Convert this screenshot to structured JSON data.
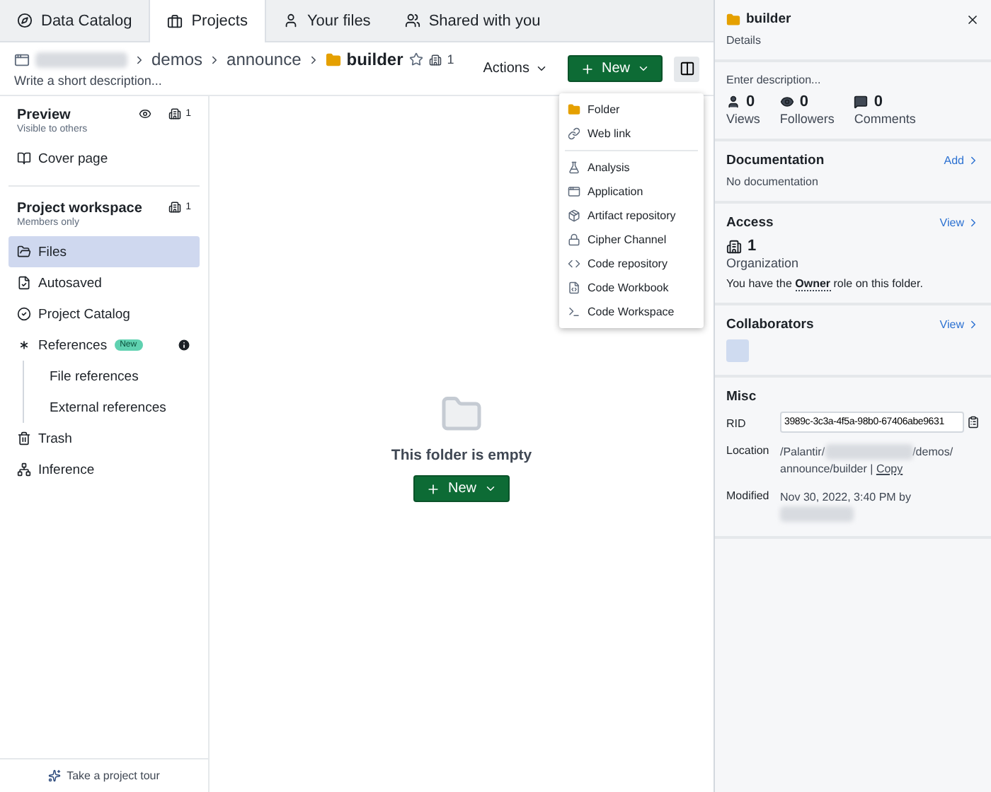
{
  "tabs": [
    {
      "label": "Data Catalog",
      "selected": false
    },
    {
      "label": "Projects",
      "selected": true
    },
    {
      "label": "Your files",
      "selected": false
    },
    {
      "label": "Shared with you",
      "selected": false
    }
  ],
  "header": {
    "breadcrumbs": [
      "demos",
      "announce"
    ],
    "current": "builder",
    "starred": false,
    "org_count": "1",
    "description_placeholder": "Write a short description...",
    "actions_label": "Actions",
    "new_label": "New"
  },
  "new_menu": {
    "groups": [
      [
        "Folder",
        "Web link"
      ],
      [
        "Analysis",
        "Application",
        "Artifact repository",
        "Cipher Channel",
        "Code repository",
        "Code Workbook",
        "Code Workspace"
      ]
    ]
  },
  "sidebar": {
    "preview": {
      "title": "Preview",
      "subtitle": "Visible to others",
      "count": "1",
      "items": [
        {
          "label": "Cover page",
          "selected": false
        }
      ]
    },
    "workspace": {
      "title": "Project workspace",
      "subtitle": "Members only",
      "count": "1",
      "items": [
        {
          "label": "Files",
          "selected": true
        },
        {
          "label": "Autosaved",
          "selected": false
        },
        {
          "label": "Project Catalog",
          "selected": false
        },
        {
          "label": "References",
          "selected": false,
          "badge": "New",
          "children": [
            {
              "label": "File references",
              "selected": false
            },
            {
              "label": "External references",
              "selected": false
            }
          ]
        },
        {
          "label": "Trash",
          "selected": false
        },
        {
          "label": "Inference",
          "selected": false
        }
      ]
    },
    "tour_label": "Take a project tour"
  },
  "empty_state": {
    "message": "This folder is empty",
    "new_label": "New"
  },
  "details": {
    "name": "builder",
    "subtitle": "Details",
    "description_placeholder": "Enter description...",
    "stats": [
      {
        "value": "0",
        "label": "Views"
      },
      {
        "value": "0",
        "label": "Followers"
      },
      {
        "value": "0",
        "label": "Comments"
      }
    ],
    "documentation": {
      "title": "Documentation",
      "action": "Add",
      "text": "No documentation"
    },
    "access": {
      "title": "Access",
      "action": "View",
      "count": "1",
      "count_label": "Organization",
      "role_text": "You have the **Owner** role on this folder."
    },
    "collaborators": {
      "title": "Collaborators",
      "action": "View"
    },
    "misc": {
      "title": "Misc",
      "rid_label": "RID",
      "rid": "3989c-3c3a-4f5a-98b0-67406abe9631",
      "location_label": "Location",
      "location_parts": [
        "/Palantir/",
        "/demos/",
        "announce/builder"
      ],
      "separator": "|",
      "copy_label": "Copy",
      "modified_label": "Modified",
      "modified": "Nov 30, 2022, 3:40 PM by"
    }
  }
}
